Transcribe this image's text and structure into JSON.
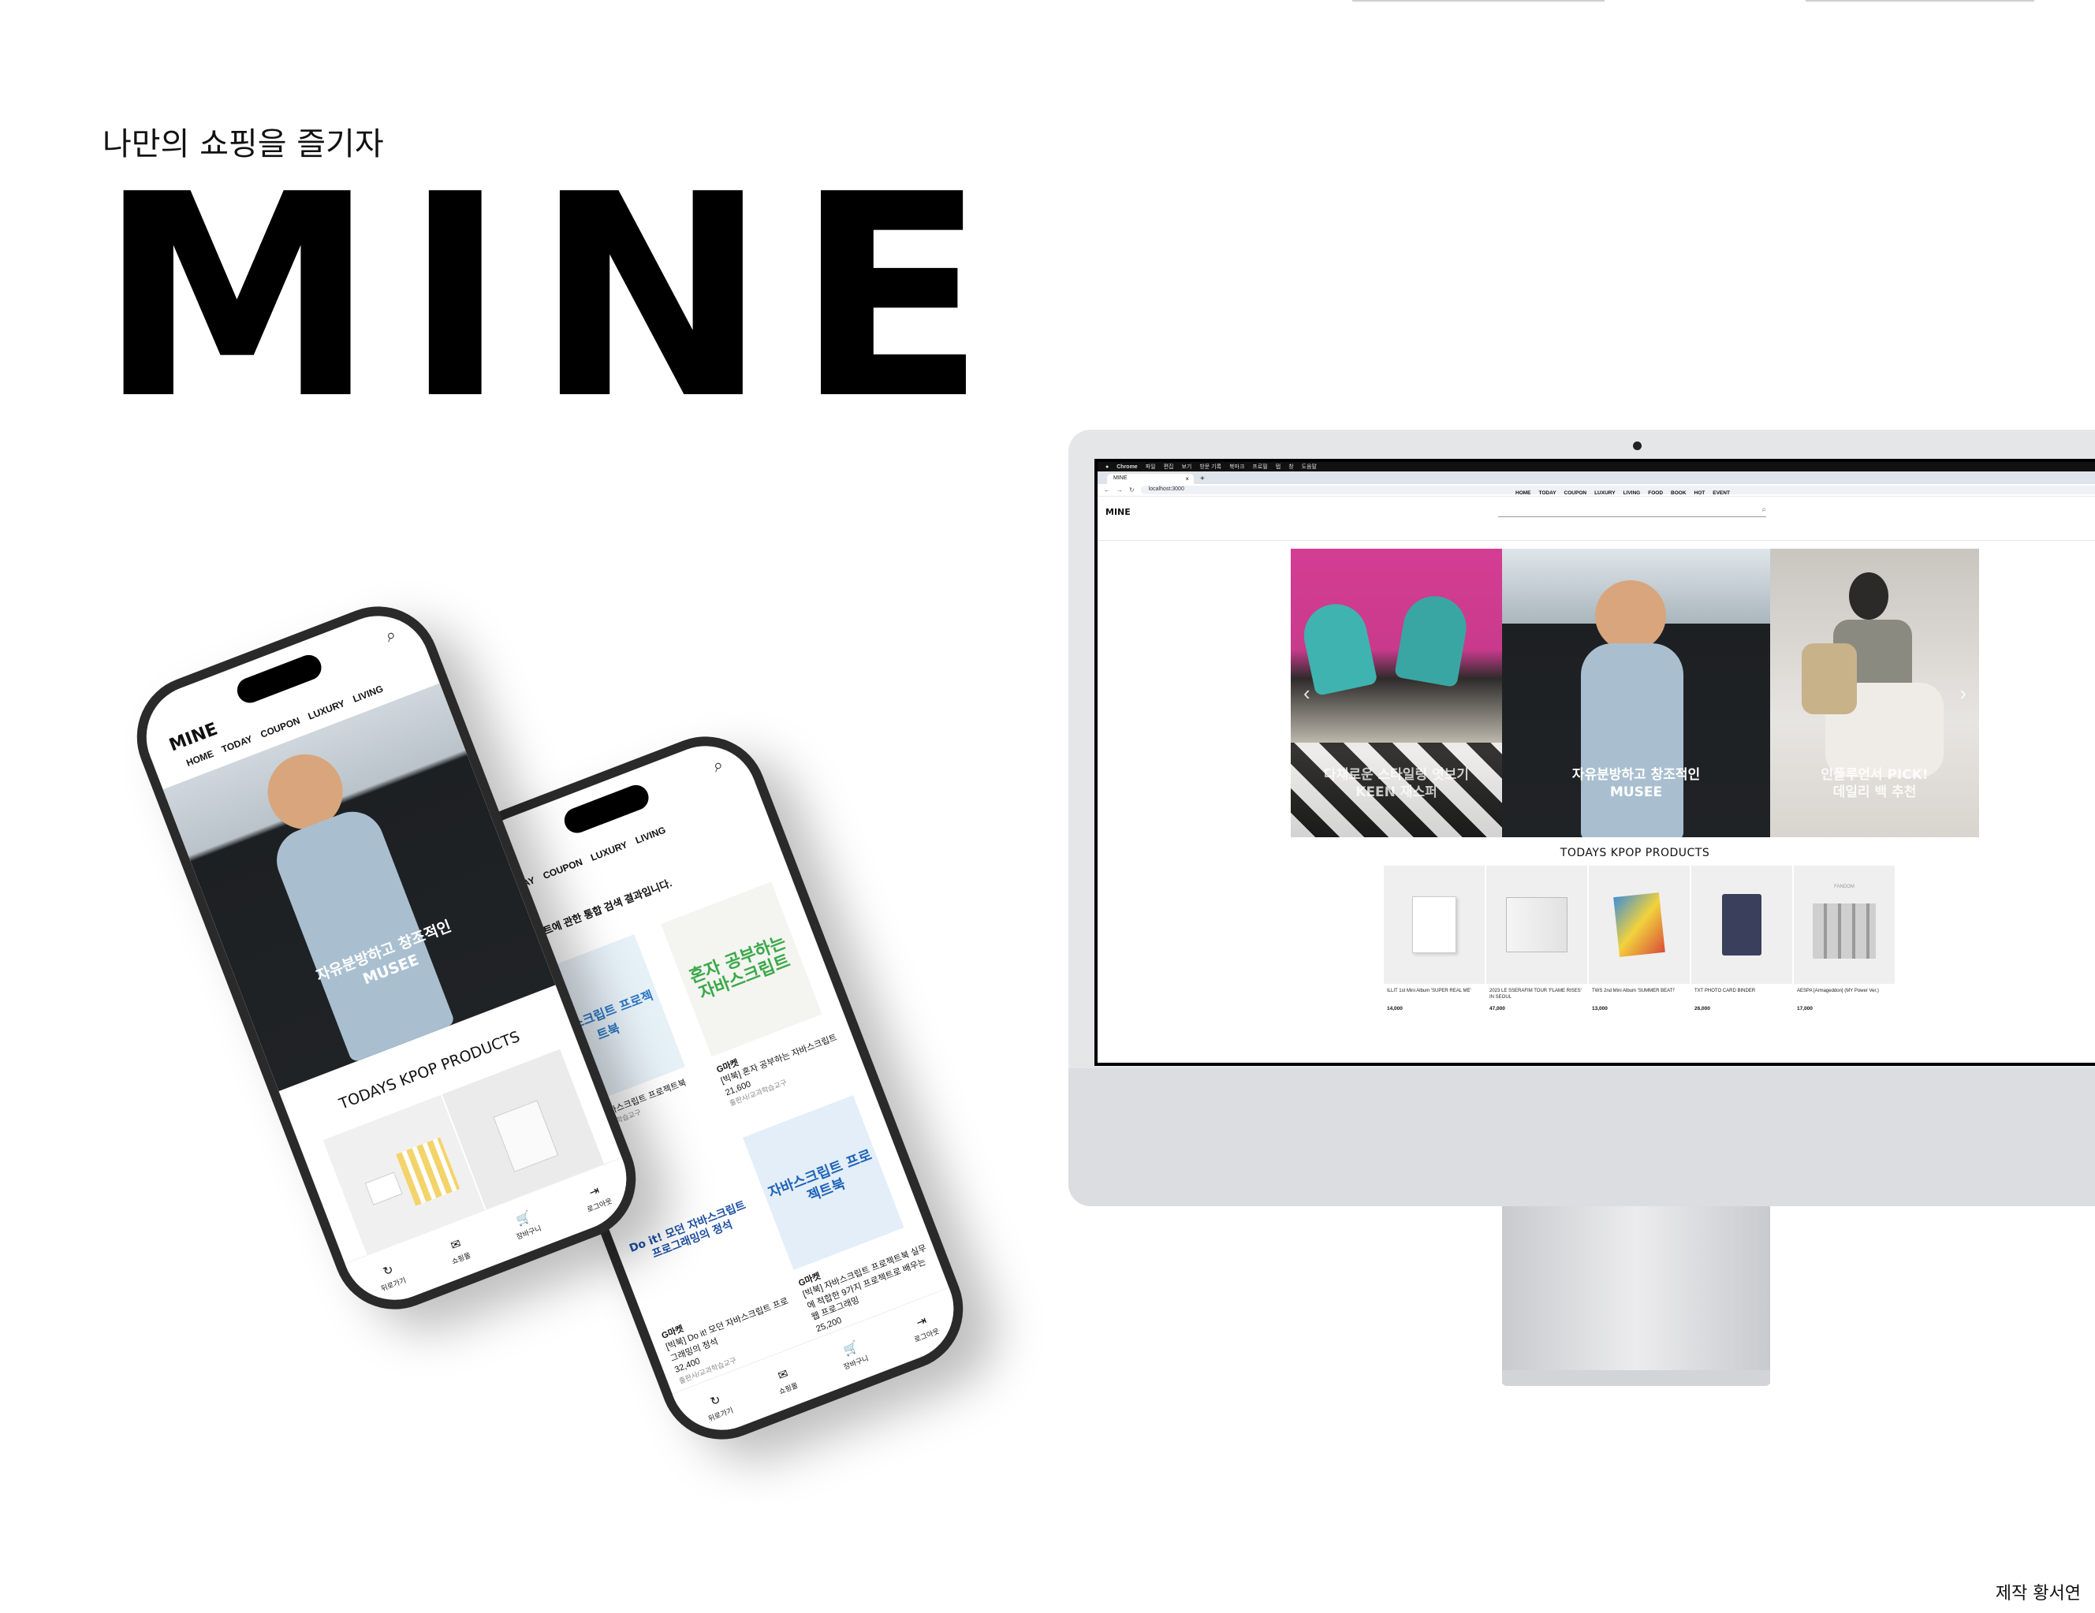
{
  "header": {
    "subtitle": "나만의 쇼핑을 즐기자",
    "brand": "MINE",
    "credit": "제작 황서연"
  },
  "desktop": {
    "mac_menu": [
      "Chrome",
      "파일",
      "편집",
      "보기",
      "방문 기록",
      "북마크",
      "프로필",
      "탭",
      "창",
      "도움말"
    ],
    "tab_title": "MINE",
    "url": "localhost:3000",
    "logo": "MINE",
    "nav": [
      "HOME",
      "TODAY",
      "COUPON",
      "LUXURY",
      "LIVING",
      "FOOD",
      "BOOK",
      "HOT",
      "EVENT"
    ],
    "slides": [
      {
        "line1": "다채로운 스타일링 엿보기",
        "line2": "KEEN 재스퍼"
      },
      {
        "line1": "자유분방하고 창조적인",
        "line2": "MUSEE"
      },
      {
        "line1": "인플루언서 PICK!",
        "line2": "데일리 백 추천"
      }
    ],
    "products_title": "TODAYS KPOP PRODUCTS",
    "products": [
      {
        "name": "ILLIT 1st Mini Album 'SUPER REAL ME'",
        "price": "14,000"
      },
      {
        "name": "2023 LE SSERAFIM TOUR 'FLAME RISES' IN SEOUL",
        "price": "47,000"
      },
      {
        "name": "TWS 2nd Mini Album 'SUMMER BEAT!'",
        "price": "13,000"
      },
      {
        "name": "TXT PHOTO CARD BINDER",
        "price": "26,000"
      },
      {
        "name": "AESPA [Armageddon] (MY Power Ver.)",
        "price": "17,000"
      }
    ],
    "product_badge": "FANDOM",
    "colors": {
      "pink": "#e0409a",
      "teal": "#3fb3b0",
      "dark": "#1c1f22"
    }
  },
  "phone1": {
    "logo": "MINE",
    "nav": [
      "HOME",
      "TODAY",
      "COUPON",
      "LUXURY",
      "LIVING"
    ],
    "hero_line1": "자유분방하고 창조적인",
    "hero_line2": "MUSEE",
    "products_title": "TODAYS KPOP PRODUCTS",
    "tabs": [
      "뒤로가기",
      "쇼핑몰",
      "장바구니",
      "로그아웃"
    ]
  },
  "phone2": {
    "nav": [
      "TODAY",
      "COUPON",
      "LUXURY",
      "LIVING"
    ],
    "result_text": "스크립트에 관한 통합 검색 결과입니다.",
    "books": [
      {
        "cover": "자바스크립트 프로젝트북",
        "store": "",
        "title": "[빅북] 자바스크립트 프로젝트북",
        "price": "",
        "pub": "출판사/교과학습교구"
      },
      {
        "cover": "혼자 공부하는 자바스크립트",
        "store": "G마켓",
        "title": "[빅북] 혼자 공부하는 자바스크립트",
        "price": "21,600",
        "pub": "출판사/교과학습교구"
      },
      {
        "cover": "Do it! 모던 자바스크립트 프로그래밍의 정석",
        "store": "G마켓",
        "title": "[빅북] Do it! 모던 자바스크립트 프로그래밍의 정석",
        "price": "32,400",
        "pub": "출판사/교과학습교구"
      },
      {
        "cover": "자바스크립트 프로젝트북",
        "store": "G마켓",
        "title": "[빅북] 자바스크립트 프로젝트북 실무에 적합한 9가지 프로젝트로 배우는 웹 프로그래밍",
        "price": "25,200",
        "pub": ""
      }
    ],
    "tabs": [
      "뒤로가기",
      "쇼핑몰",
      "장바구니",
      "로그아웃"
    ]
  }
}
